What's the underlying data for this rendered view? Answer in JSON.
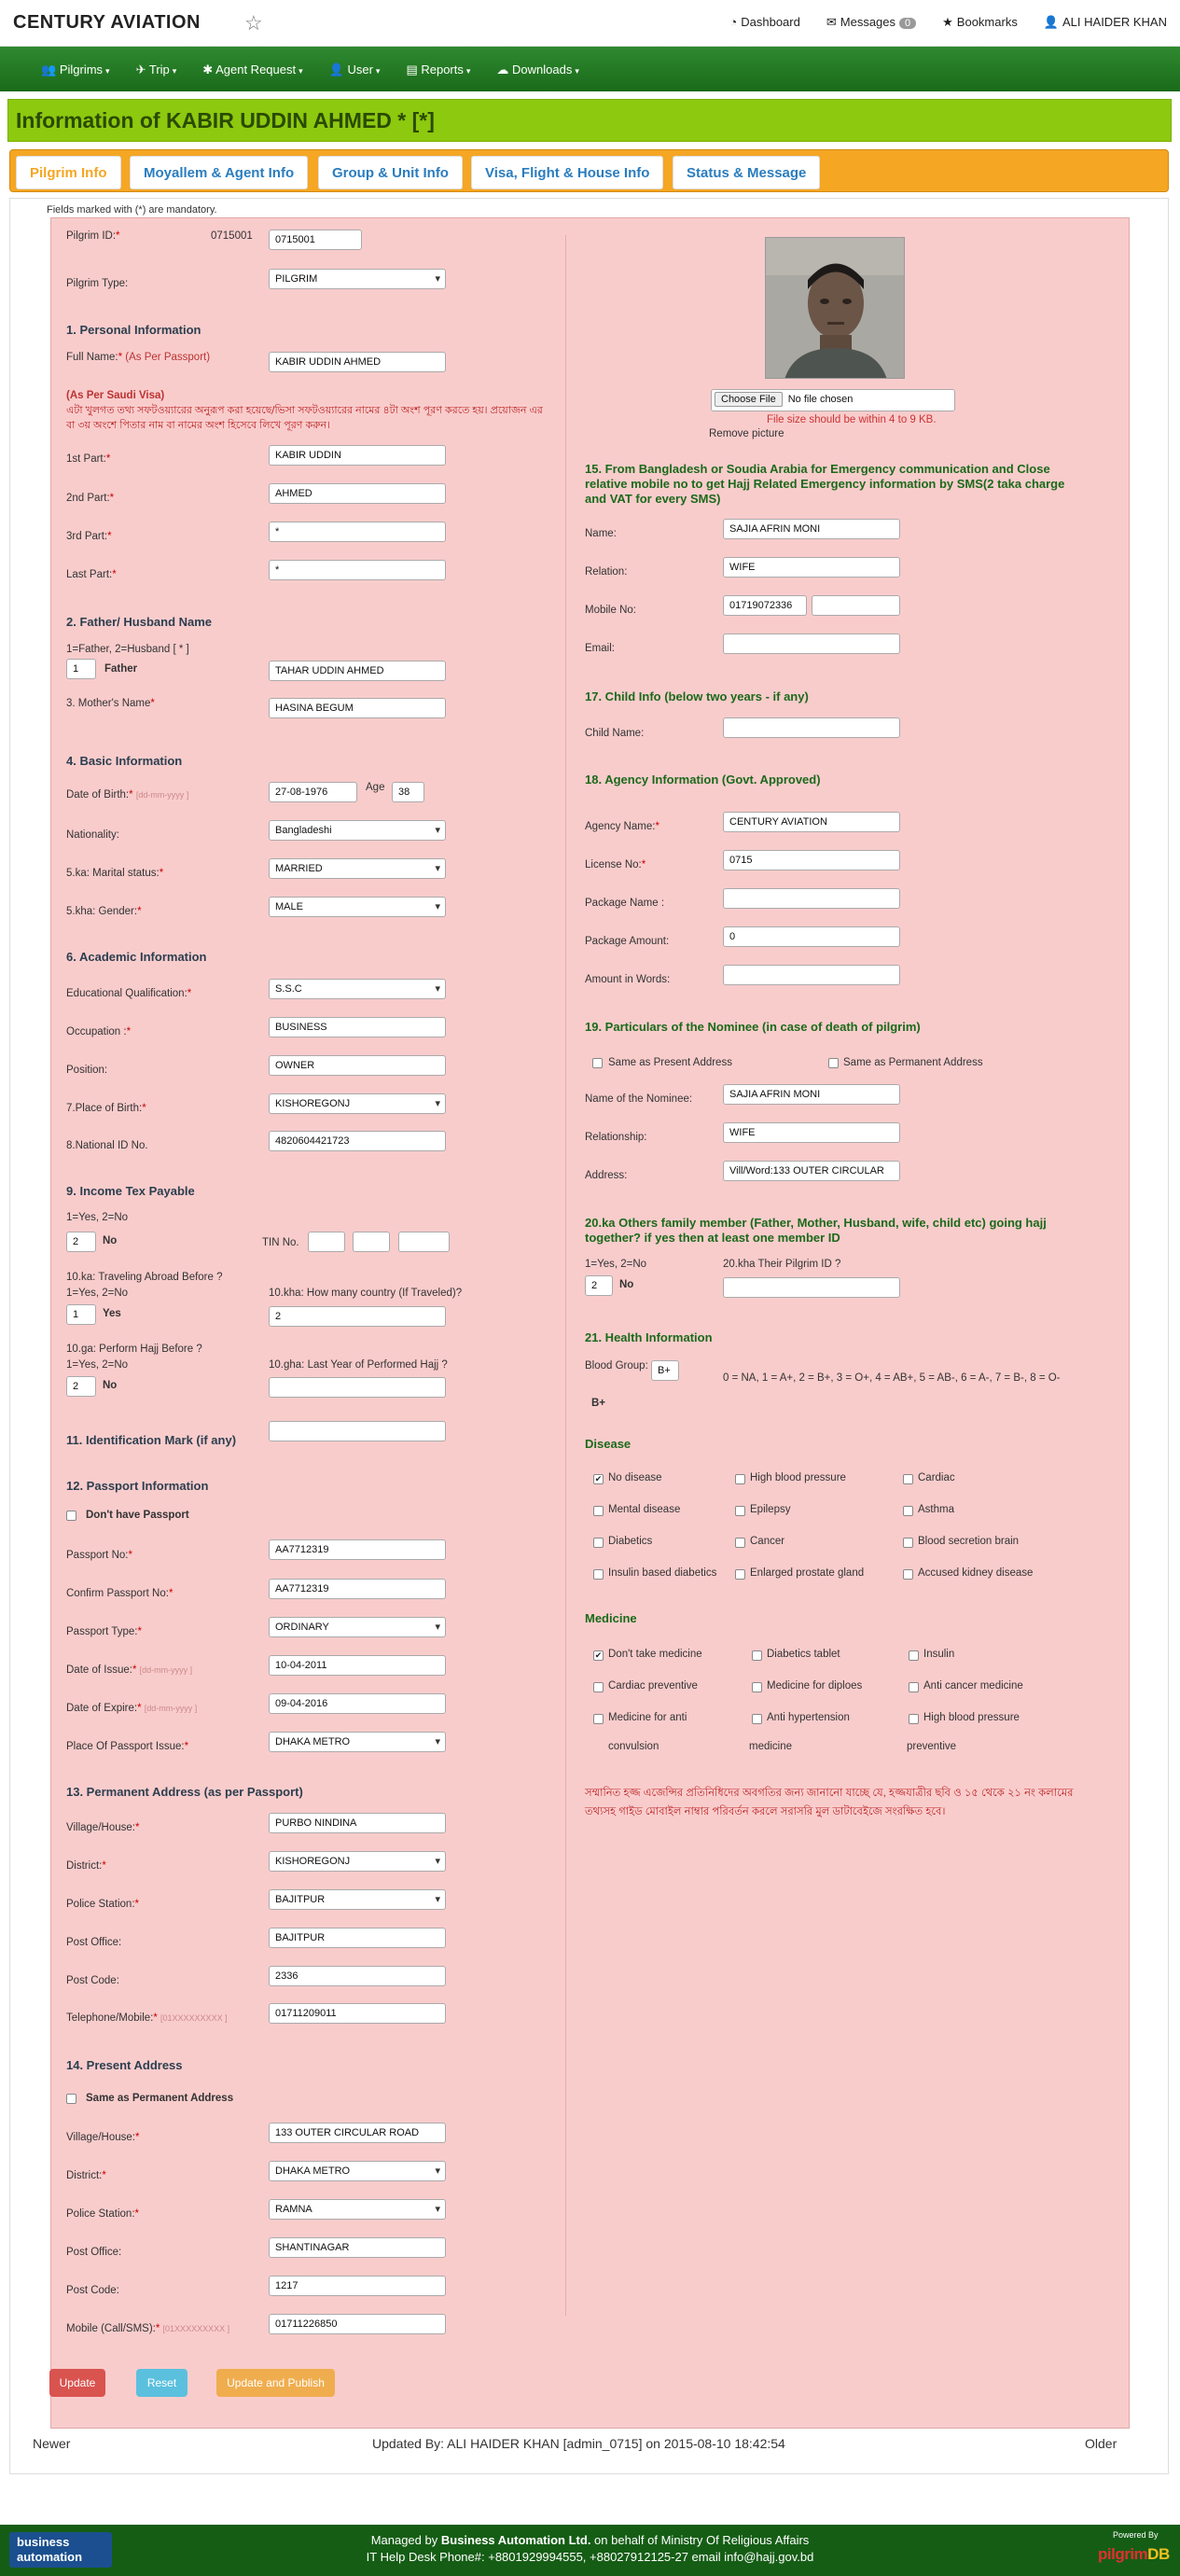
{
  "topbar": {
    "brand": "CENTURY AVIATION",
    "dashboard": "Dashboard",
    "messages": "Messages",
    "messages_count": "0",
    "bookmarks": "Bookmarks",
    "user": "ALI HAIDER KHAN"
  },
  "nav": [
    "Pilgrims",
    "Trip",
    "Agent Request",
    "User",
    "Reports",
    "Downloads"
  ],
  "title": "Information of KABIR UDDIN AHMED * [*]",
  "tabs": [
    "Pilgrim Info",
    "Moyallem & Agent Info",
    "Group & Unit Info",
    "Visa, Flight & House Info",
    "Status & Message"
  ],
  "mandatory_note": "Fields marked with (*) are mandatory.",
  "left": {
    "pilgrim_id_label": "Pilgrim ID:",
    "pilgrim_id_text": "0715001",
    "pilgrim_id_value": "0715001",
    "pilgrim_type_label": "Pilgrim Type:",
    "pilgrim_type": "PILGRIM",
    "s1": "1. Personal Information",
    "full_name_label": "Full Name:",
    "full_name_hint": "(As Per Passport)",
    "full_name": "KABIR UDDIN AHMED",
    "visa_title": "(As Per Saudi Visa)",
    "visa_note": "এটা খুলগত তথ্য সফটওয়্যারের অনুরূপ করা হয়েছে/ভিসা সফটওয়্যারের নামের ৪টা অংশ পূরণ করতে হয়। প্রয়োজন এর বা ৩য় অংশে পিতার নাম বা নামের অংশ হিসেবে লিখে পূরণ করুন।",
    "p1_label": "1st Part:",
    "p1": "KABIR UDDIN",
    "p2_label": "2nd Part:",
    "p2": "AHMED",
    "p3_label": "3rd Part:",
    "p3": "*",
    "p4_label": "Last Part:",
    "p4": "*",
    "s2": "2. Father/ Husband Name",
    "fh_hint": "1=Father, 2=Husband [ * ]",
    "fh_code": "1",
    "fh_code_label": "Father",
    "father_name": "TAHAR UDDIN AHMED",
    "mother_label": "3. Mother's Name",
    "mother": "HASINA BEGUM",
    "s4": "4. Basic Information",
    "dob_label": "Date of Birth:",
    "date_hint": "[dd-mm-yyyy ]",
    "dob": "27-08-1976",
    "age_label": "Age",
    "age": "38",
    "nationality_label": "Nationality:",
    "nationality": "Bangladeshi",
    "marital_label": "5.ka: Marital status:",
    "marital": "MARRIED",
    "gender_label": "5.kha: Gender:",
    "gender": "MALE",
    "s6": "6. Academic Information",
    "edu_label": "Educational Qualification:",
    "edu": "S.S.C",
    "occ_label": "Occupation :",
    "occ": "BUSINESS",
    "pos_label": "Position:",
    "pos": "OWNER",
    "pob_label": "7.Place of Birth:",
    "pob": "KISHOREGONJ",
    "nid_label": "8.National ID No.",
    "nid": "4820604421723",
    "s9": "9. Income Tex Payable",
    "yn_hint": "1=Yes, 2=No",
    "tax_code": "2",
    "tax_label": "No",
    "tin_label": "TIN No.",
    "travel_label": "10.ka: Traveling Abroad Before ?",
    "travel_code": "1",
    "travel_text": "Yes",
    "countries_label": "10.kha: How many country (If Traveled)?",
    "countries": "2",
    "hajj_label": "10.ga: Perform Hajj Before ?",
    "hajj_code": "2",
    "hajj_text": "No",
    "lasthajj_label": "10.gha: Last Year of Performed Hajj ?",
    "s11": "11. Identification Mark (if any)",
    "s12": "12. Passport Information",
    "no_passport": "Don't have Passport",
    "pass_label": "Passport No:",
    "pass": "AA7712319",
    "cpass_label": "Confirm Passport No:",
    "cpass": "AA7712319",
    "ptype_label": "Passport Type:",
    "ptype": "ORDINARY",
    "issue_label": "Date of Issue:",
    "issue": "10-04-2011",
    "expire_label": "Date of Expire:",
    "expire": "09-04-2016",
    "poi_label": "Place Of Passport Issue:",
    "poi": "DHAKA METRO",
    "s13": "13. Permanent Address (as per Passport)",
    "village_label": "Village/House:",
    "perm_village": "PURBO NINDINA",
    "district_label": "District:",
    "perm_district": "KISHOREGONJ",
    "ps_label": "Police Station:",
    "perm_ps": "BAJITPUR",
    "po_label": "Post Office:",
    "perm_po": "BAJITPUR",
    "pc_label": "Post Code:",
    "perm_pc": "2336",
    "tel_label": "Telephone/Mobile:",
    "phone_hint": "[01XXXXXXXXX ]",
    "perm_tel": "01711209011",
    "s14": "14. Present Address",
    "same_perm": "Same as Permanent Address",
    "pres_village": "133 OUTER CIRCULAR ROAD",
    "pres_district": "DHAKA METRO",
    "pres_ps": "RAMNA",
    "pres_po": "SHANTINAGAR",
    "pres_pc": "1217",
    "mobile_label": "Mobile (Call/SMS):",
    "pres_mobile": "01711226850"
  },
  "buttons": {
    "update": "Update",
    "reset": "Reset",
    "publish": "Update and Publish"
  },
  "right": {
    "choose_file": "Choose File",
    "no_file": "No file chosen",
    "file_note": "File size should be within 4 to 9 KB.",
    "remove": "Remove picture",
    "s15": "15. From Bangladesh or Soudia Arabia for Emergency communication and Close relative mobile no to get Hajj Related Emergency information by SMS(2 taka charge and VAT for every SMS)",
    "name_label": "Name:",
    "ec_name": "SAJIA AFRIN MONI",
    "relation_label": "Relation:",
    "ec_relation": "WIFE",
    "mobile_label": "Mobile No:",
    "ec_mobile": "01719072336",
    "email_label": "Email:",
    "s17": "17. Child Info (below two years - if any)",
    "child_label": "Child Name:",
    "s18": "18. Agency Information (Govt. Approved)",
    "agency_label": "Agency Name:",
    "agency": "CENTURY AVIATION",
    "license_label": "License No:",
    "license": "0715",
    "pkgname_label": "Package Name :",
    "pkgamt_label": "Package Amount:",
    "pkgamt": "0",
    "words_label": "Amount in Words:",
    "s19": "19. Particulars of the Nominee (in case of death of pilgrim)",
    "same_present": "Same as Present Address",
    "same_permanent": "Same as Permanent Address",
    "nominee_label": "Name of the Nominee:",
    "nominee": "SAJIA AFRIN MONI",
    "rel_label": "Relationship:",
    "nominee_rel": "WIFE",
    "address_label": "Address:",
    "nominee_addr": "Vill/Word:133 OUTER CIRCULAR",
    "s20": "20.ka Others family member (Father, Mother, Husband, wife, child etc) going hajj together? if yes then at least one member ID",
    "yn_hint": "1=Yes, 2=No",
    "fam_code": "2",
    "fam_text": "No",
    "their_id_label": "20.kha Their Pilgrim ID ?",
    "s21": "21. Health Information",
    "blood_label": "Blood Group:",
    "blood": "B+",
    "blood_legend": "0 = NA, 1 = A+, 2 = B+, 3 = O+, 4 = AB+, 5 = AB-, 6 = A-, 7 = B-, 8 = O-",
    "disease_title": "Disease",
    "diseases": [
      "No disease",
      "High blood pressure",
      "Cardiac",
      "Mental disease",
      "Epilepsy",
      "Asthma",
      "Diabetics",
      "Cancer",
      "Blood secretion brain",
      "Insulin based diabetics",
      "Enlarged prostate gland",
      "Accused kidney disease"
    ],
    "medicine_title": "Medicine",
    "medicines": [
      "Don't take medicine",
      "Diabetics tablet",
      "Insulin",
      "Cardiac preventive",
      "Medicine for diploes",
      "Anti cancer medicine",
      "Medicine for anti",
      "Anti hypertension",
      "High blood pressure"
    ],
    "medicine_wrap": [
      "convulsion",
      "medicine",
      "preventive"
    ],
    "bn_note": "সম্মানিত হজ্জ এজেন্সির প্রতিনিধিদের অবগতির জন্য জানানো যাচ্ছে যে, হজ্জযাত্রীর ছবি ও ১৫ থেকে ২১ নং কলামের তথ্যসহ গাইড মোবাইল নাম্বার পরিবর্তন করলে সরাসরি মুল ডাটাবেইজে সংরক্ষিত হবে।"
  },
  "bottom": {
    "newer": "Newer",
    "updated": "Updated By: ALI HAIDER KHAN [admin_0715] on 2015-08-10 18:42:54",
    "older": "Older"
  },
  "footer": {
    "logo1": "business",
    "logo2": "automation",
    "line1_pre": "Managed by ",
    "line1_bold": "Business Automation Ltd.",
    "line1_post": " on behalf of Ministry Of Religious Affairs",
    "line2": "IT Help Desk Phone#: +8801929994555, +88027912125-27 email info@hajj.gov.bd",
    "powered": "Powered By",
    "db1": "pilgrim",
    "db2": "DB"
  }
}
